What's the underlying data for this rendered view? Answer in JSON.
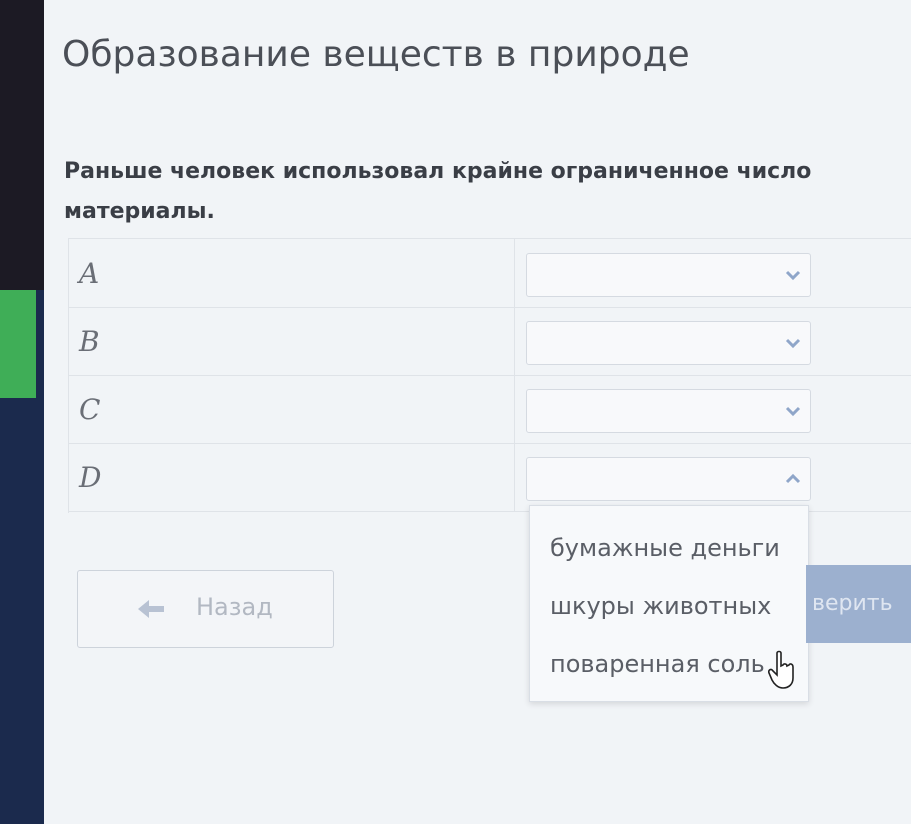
{
  "page": {
    "title": "Образование веществ в природе",
    "question_line1": "Раньше человек использовал крайне ограниченное число",
    "question_line2": "материалы."
  },
  "rows": [
    {
      "label": "A",
      "value": "",
      "state": "collapsed"
    },
    {
      "label": "B",
      "value": "",
      "state": "collapsed"
    },
    {
      "label": "C",
      "value": "",
      "state": "collapsed"
    },
    {
      "label": "D",
      "value": "",
      "state": "expanded"
    }
  ],
  "dropdown": {
    "options": [
      "бумажные деньги",
      "шкуры животных",
      "поваренная соль"
    ]
  },
  "buttons": {
    "back_label": "Назад",
    "check_label": "верить"
  },
  "colors": {
    "accent": "#9cb0cf",
    "chevron": "#8fa6c9",
    "sidebar_green": "#3fae57"
  },
  "icons": {
    "back": "arrow-left-icon",
    "collapsed": "chevron-down-icon",
    "expanded": "chevron-up-icon",
    "cursor": "hand-pointer-icon"
  }
}
